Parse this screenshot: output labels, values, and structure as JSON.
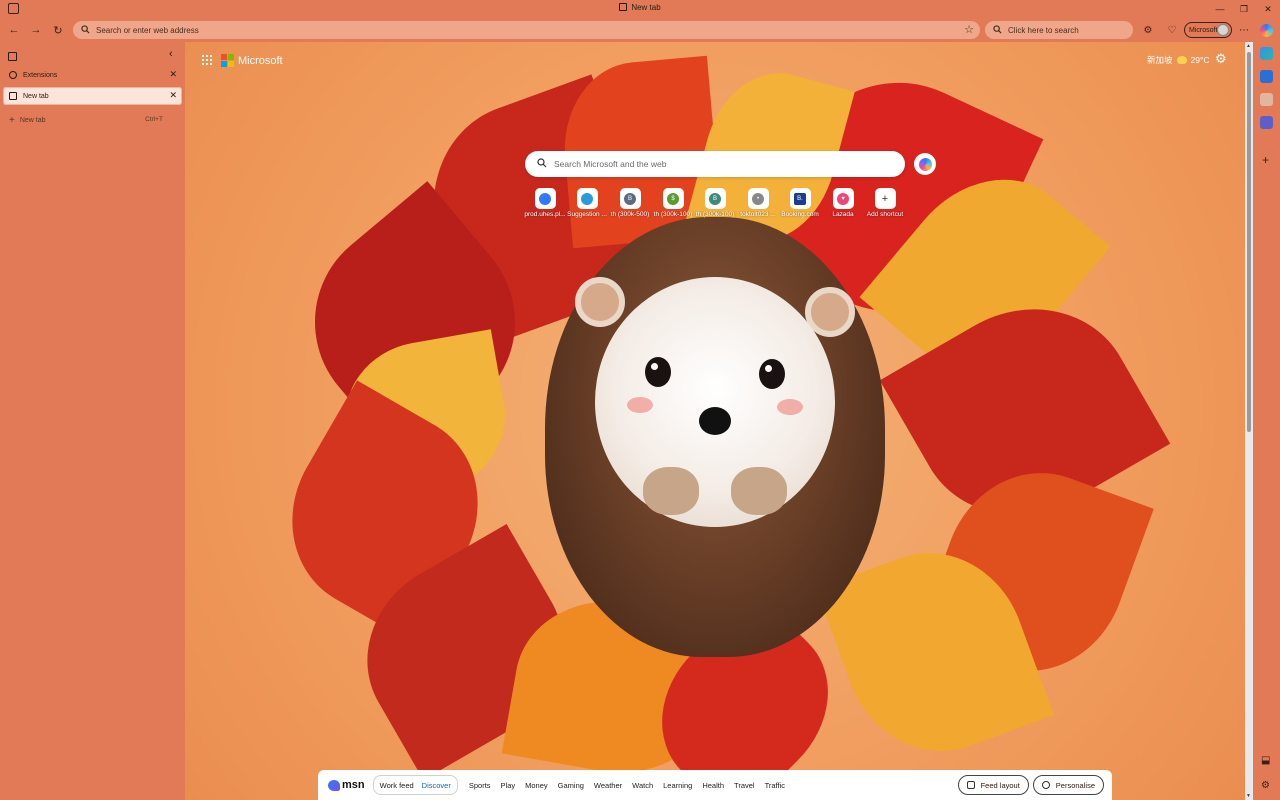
{
  "window": {
    "title": "New tab",
    "controls": {
      "minimize": "—",
      "restore": "❐",
      "close": "✕"
    }
  },
  "toolbar": {
    "address_placeholder": "Search or enter web address",
    "search_placeholder": "Click here to search",
    "profile_label": "Microsoft"
  },
  "sidebar": {
    "tabs": [
      {
        "label": "Extensions",
        "active": false
      },
      {
        "label": "New tab",
        "active": true
      }
    ],
    "new_tab_label": "New tab",
    "new_tab_shortcut": "Ctrl+T"
  },
  "ntp": {
    "brand": "Microsoft",
    "weather": {
      "location": "新加坡",
      "temp": "29°C"
    },
    "search_placeholder": "Search Microsoft and the web",
    "shortcuts": [
      {
        "label": "prod.uhes.pl...",
        "color": "#2d7cf6",
        "glyph": ""
      },
      {
        "label": "Suggestion ...",
        "color": "#2a9bd8",
        "glyph": ""
      },
      {
        "label": "th (300k-500)",
        "color": "#5b6b80",
        "glyph": "B"
      },
      {
        "label": "th (300k-100)",
        "color": "#5a9b2a",
        "glyph": "$"
      },
      {
        "label": "th (300k-100)",
        "color": "#3c8a7a",
        "glyph": "B"
      },
      {
        "label": "toktolt023 ...",
        "color": "#888888",
        "glyph": "•"
      },
      {
        "label": "Booking.com",
        "color": "#1a3d8f",
        "glyph": "B."
      },
      {
        "label": "Lazada",
        "color": "#f0457a",
        "glyph": "♥"
      },
      {
        "label": "Add shortcut",
        "color": "#ffffff",
        "glyph": "+"
      }
    ]
  },
  "feed": {
    "brand": "msn",
    "toggle": [
      "Work feed",
      "Discover"
    ],
    "categories": [
      "Sports",
      "Play",
      "Money",
      "Gaming",
      "Weather",
      "Watch",
      "Learning",
      "Health",
      "Travel",
      "Traffic"
    ],
    "layout_label": "Feed layout",
    "personalise_label": "Personalise"
  },
  "colors": {
    "chrome": "#e27a57",
    "address_bar": "#f0a68a",
    "active_tab": "#fbe4d9",
    "accent": "#0f6cbd"
  }
}
